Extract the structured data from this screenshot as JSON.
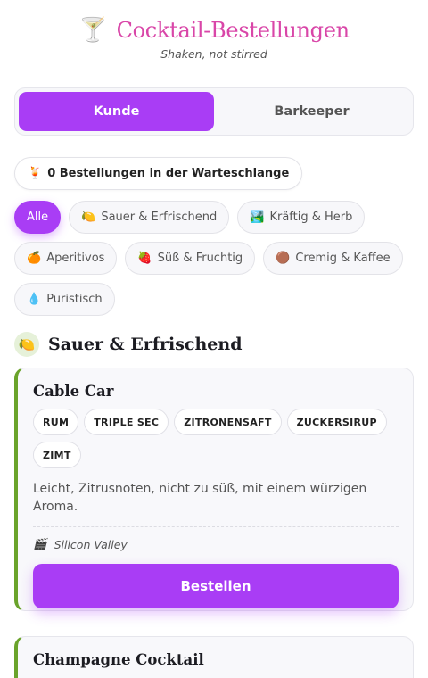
{
  "header": {
    "icon": "cocktail-glass-icon",
    "icon_glyph": "🍸",
    "title": "Cocktail-Bestellungen",
    "subtitle": "Shaken, not stirred",
    "title_color": "#d946a8"
  },
  "mode_toggle": {
    "options": [
      {
        "label": "Kunde",
        "active": true
      },
      {
        "label": "Barkeeper",
        "active": false
      }
    ],
    "accent_color": "#a93df5"
  },
  "queue": {
    "icon": "tropical-drink-icon",
    "icon_glyph": "🍹",
    "label": "0 Bestellungen in der Warteschlange"
  },
  "filters": [
    {
      "label": "Alle",
      "icon": "",
      "icon_glyph": "",
      "active": true
    },
    {
      "label": "Sauer & Erfrischend",
      "icon": "lemon-icon",
      "icon_glyph": "🍋",
      "active": false
    },
    {
      "label": "Kräftig & Herb",
      "icon": "landscape-icon",
      "icon_glyph": "🏞️",
      "active": false
    },
    {
      "label": "Aperitivos",
      "icon": "orange-icon",
      "icon_glyph": "🍊",
      "active": false
    },
    {
      "label": "Süß & Fruchtig",
      "icon": "strawberry-icon",
      "icon_glyph": "🍓",
      "active": false
    },
    {
      "label": "Cremig & Kaffee",
      "icon": "coffee-bean-icon",
      "icon_glyph": "🟤",
      "active": false
    },
    {
      "label": "Puristisch",
      "icon": "droplet-icon",
      "icon_glyph": "💧",
      "active": false
    }
  ],
  "section": {
    "icon": "lemon-icon",
    "icon_glyph": "🍋",
    "label": "Sauer & Erfrischend",
    "accent_color": "#6aa32b"
  },
  "cocktails": [
    {
      "name": "Cable Car",
      "ingredients": [
        "RUM",
        "TRIPLE SEC",
        "ZITRONENSAFT",
        "ZUCKERSIRUP",
        "ZIMT"
      ],
      "description": "Leicht, Zitrusnoten, nicht zu süß, mit einem würzigen Aroma.",
      "source_icon": "clapperboard-icon",
      "source_icon_glyph": "🎬",
      "source": "Silicon Valley",
      "order_label": "Bestellen"
    },
    {
      "name": "Champagne Cocktail",
      "ingredients": [],
      "description": "",
      "source": "",
      "order_label": ""
    }
  ]
}
